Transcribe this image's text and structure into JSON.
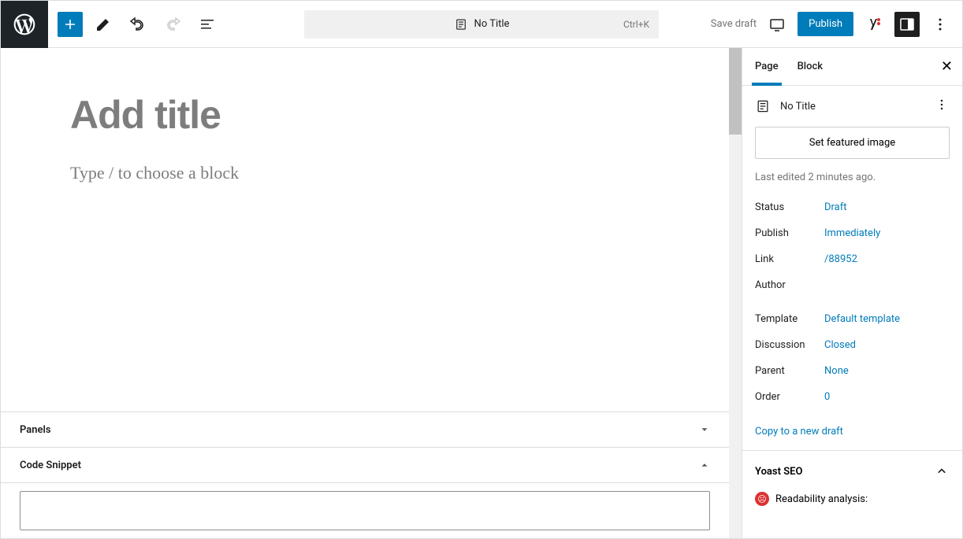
{
  "topbar": {
    "doc_title": "No Title",
    "shortcut": "Ctrl+K",
    "save_draft": "Save draft",
    "publish": "Publish"
  },
  "editor": {
    "title_placeholder": "Add title",
    "block_placeholder": "Type / to choose a block"
  },
  "panels": {
    "panels_label": "Panels",
    "code_snippet_label": "Code Snippet"
  },
  "sidebar": {
    "tabs": {
      "page": "Page",
      "block": "Block"
    },
    "doc_title": "No Title",
    "featured_image": "Set featured image",
    "last_edited": "Last edited 2 minutes ago.",
    "rows": {
      "status": {
        "k": "Status",
        "v": "Draft"
      },
      "publish": {
        "k": "Publish",
        "v": "Immediately"
      },
      "link": {
        "k": "Link",
        "v": "/88952"
      },
      "author": {
        "k": "Author",
        "v": ""
      },
      "template": {
        "k": "Template",
        "v": "Default template"
      },
      "discussion": {
        "k": "Discussion",
        "v": "Closed"
      },
      "parent": {
        "k": "Parent",
        "v": "None"
      },
      "order": {
        "k": "Order",
        "v": "0"
      }
    },
    "copy_draft": "Copy to a new draft",
    "yoast_label": "Yoast SEO",
    "readability": "Readability analysis:"
  }
}
